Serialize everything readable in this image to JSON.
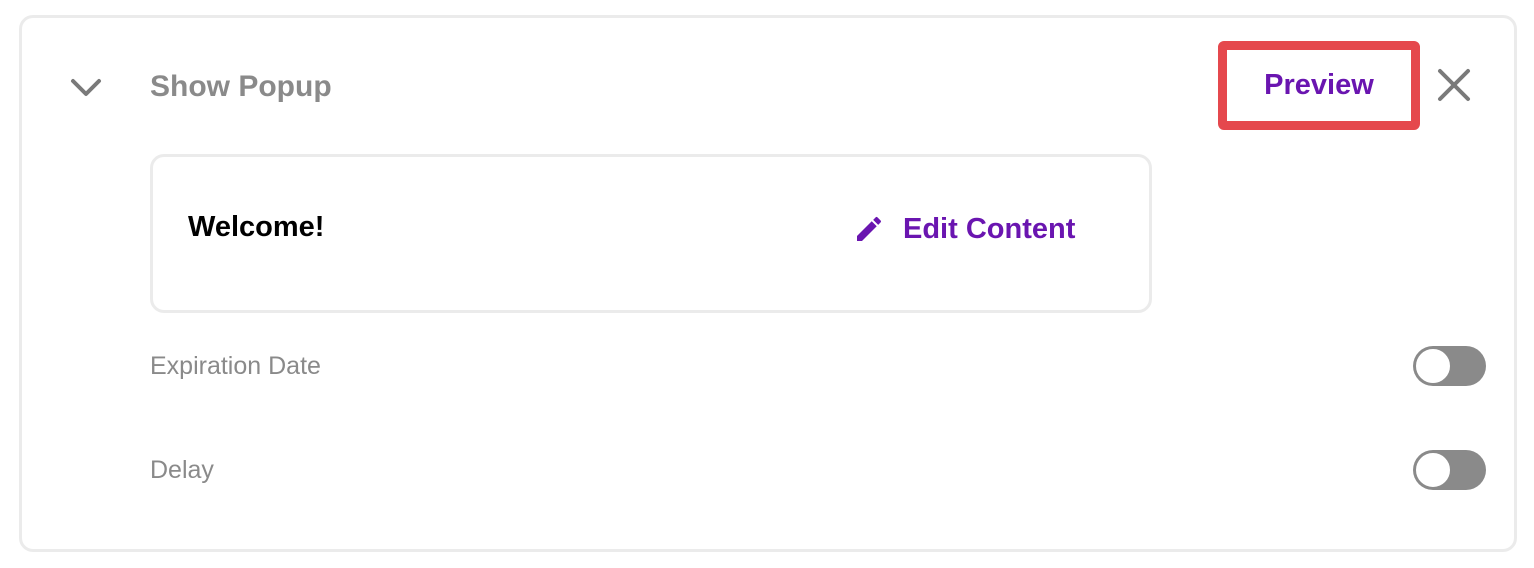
{
  "header": {
    "collapse_icon": "chevron-down-icon",
    "title": "Show Popup",
    "preview_label": "Preview",
    "close_icon": "close-icon"
  },
  "content_card": {
    "title": "Welcome!",
    "edit_icon": "pencil-icon",
    "edit_label": "Edit Content"
  },
  "settings": [
    {
      "label": "Expiration Date",
      "enabled": false
    },
    {
      "label": "Delay",
      "enabled": false
    }
  ],
  "colors": {
    "accent": "#6a15b0",
    "highlight_border": "#e5484d",
    "muted_text": "#8a8a8a",
    "border": "#ebebeb"
  }
}
